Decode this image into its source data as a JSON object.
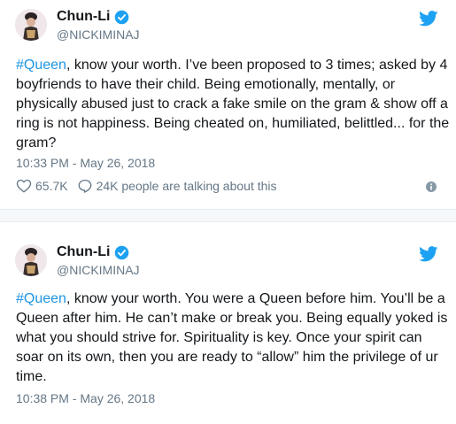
{
  "tweets": [
    {
      "name": "Chun-Li",
      "handle": "@NICKIMINAJ",
      "hashtag": "#Queen",
      "text": ", know your worth. I’ve been proposed to 3 times; asked by 4 boyfriends to have their child. Being emotionally, mentally, or physically abused just to crack a fake smile on the gram & show off a ring is not happiness. Being cheated on, humiliated, belittled... for the gram?",
      "time": "10:33 PM - May 26, 2018",
      "likes": "65.7K",
      "talking": "24K people are talking about this"
    },
    {
      "name": "Chun-Li",
      "handle": "@NICKIMINAJ",
      "hashtag": "#Queen",
      "text": ", know your worth. You were a Queen before him. You’ll be a Queen after him. He can’t make or break you. Being equally yoked is what you should strive for. Spirituality is key. Once your spirit can soar on its own, then you are ready to “allow” him the privilege of ur time.",
      "time": "10:38 PM - May 26, 2018"
    }
  ],
  "colors": {
    "accent": "#1da1f2",
    "hashtag": "#1b95e0",
    "muted": "#657786",
    "text": "#14171a"
  },
  "icons": {
    "verified": "verified-badge-icon",
    "bird": "twitter-bird-icon",
    "heart": "heart-icon",
    "reply": "speech-bubble-icon",
    "info": "info-icon"
  }
}
